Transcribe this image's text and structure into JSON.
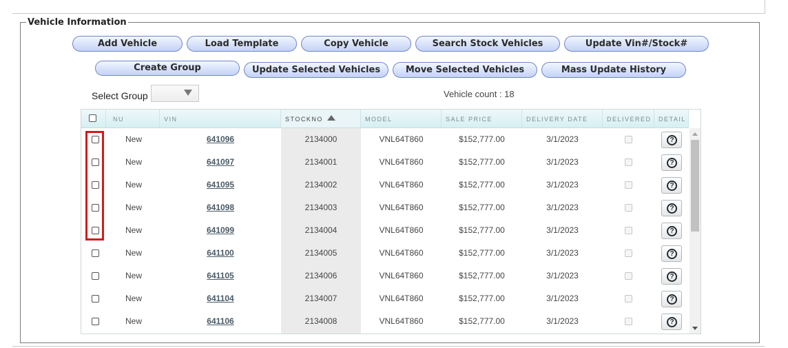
{
  "section": {
    "legend": "Vehicle Information"
  },
  "buttons_row1": [
    "Add Vehicle",
    "Load Template",
    "Copy Vehicle",
    "Search Stock Vehicles",
    "Update Vin#/Stock#"
  ],
  "buttons_row2": [
    "Create Group",
    "Update Selected Vehicles",
    "Move Selected Vehicles",
    "Mass Update History"
  ],
  "group_select": {
    "label": "Select Group",
    "value": ""
  },
  "vehicle_count": "Vehicle count : 18",
  "grid": {
    "sort_column": "STOCKNO",
    "sort_direction": "ascending",
    "columns": [
      "NU",
      "VIN",
      "STOCKNO",
      "MODEL",
      "SALE PRICE",
      "DELIVERY DATE",
      "DELIVERED",
      "DETAIL"
    ],
    "rows": [
      {
        "nu": "New",
        "vin": "641096",
        "stockno": "2134000",
        "model": "VNL64T860",
        "sale_price": "$152,777.00",
        "delivery_date": "3/1/2023"
      },
      {
        "nu": "New",
        "vin": "641097",
        "stockno": "2134001",
        "model": "VNL64T860",
        "sale_price": "$152,777.00",
        "delivery_date": "3/1/2023"
      },
      {
        "nu": "New",
        "vin": "641095",
        "stockno": "2134002",
        "model": "VNL64T860",
        "sale_price": "$152,777.00",
        "delivery_date": "3/1/2023"
      },
      {
        "nu": "New",
        "vin": "641098",
        "stockno": "2134003",
        "model": "VNL64T860",
        "sale_price": "$152,777.00",
        "delivery_date": "3/1/2023"
      },
      {
        "nu": "New",
        "vin": "641099",
        "stockno": "2134004",
        "model": "VNL64T860",
        "sale_price": "$152,777.00",
        "delivery_date": "3/1/2023"
      },
      {
        "nu": "New",
        "vin": "641100",
        "stockno": "2134005",
        "model": "VNL64T860",
        "sale_price": "$152,777.00",
        "delivery_date": "3/1/2023"
      },
      {
        "nu": "New",
        "vin": "641105",
        "stockno": "2134006",
        "model": "VNL64T860",
        "sale_price": "$152,777.00",
        "delivery_date": "3/1/2023"
      },
      {
        "nu": "New",
        "vin": "641104",
        "stockno": "2134007",
        "model": "VNL64T860",
        "sale_price": "$152,777.00",
        "delivery_date": "3/1/2023"
      },
      {
        "nu": "New",
        "vin": "641106",
        "stockno": "2134008",
        "model": "VNL64T860",
        "sale_price": "$152,777.00",
        "delivery_date": "3/1/2023"
      }
    ]
  },
  "icons": {
    "help": "question-mark-icon",
    "sort": "sort-ascending-icon",
    "dropdown": "chevron-down-icon"
  },
  "colors": {
    "highlight": "#d41a1a",
    "button_border": "#6f86c9",
    "header_bg": "#d7eff2"
  }
}
